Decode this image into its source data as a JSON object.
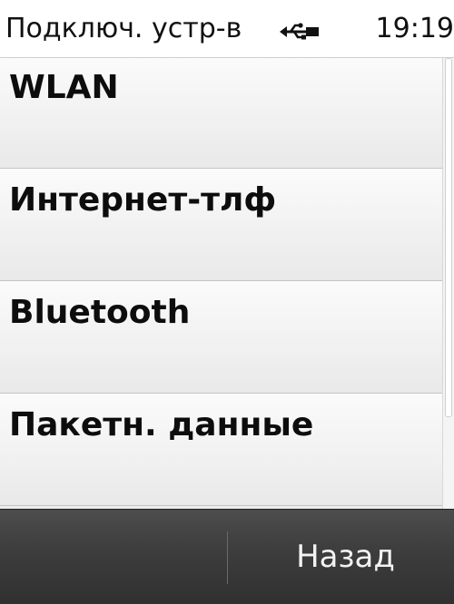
{
  "status_bar": {
    "title": "Подключ. устр-в",
    "usb_icon": "usb-connection-icon",
    "time": "19:19"
  },
  "list": {
    "items": [
      {
        "label": "WLAN"
      },
      {
        "label": "Интернет-тлф"
      },
      {
        "label": "Bluetooth"
      },
      {
        "label": "Пакетн. данные"
      }
    ]
  },
  "softkeys": {
    "back_label": "Назад"
  },
  "colors": {
    "status_bar_bg": "#ffffff",
    "list_bg": "#f1f1f1",
    "softkey_bar_bg": "#3e3e3e",
    "softkey_text": "#f2f2f2"
  }
}
